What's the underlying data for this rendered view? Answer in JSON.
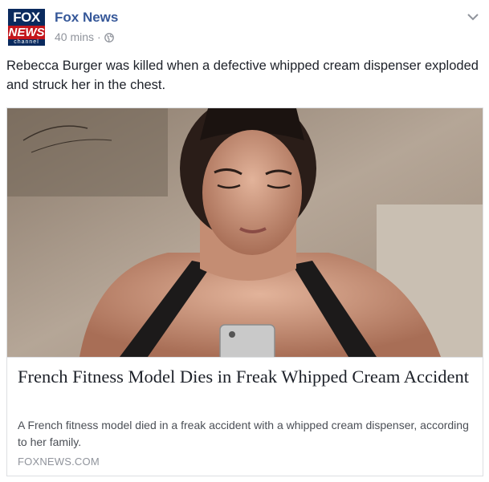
{
  "page": {
    "name": "Fox News",
    "logo_top": "FOX",
    "logo_bottom": "NEWS",
    "logo_channel": "channel"
  },
  "post": {
    "timestamp": "40 mins",
    "separator": "·",
    "privacy_icon": "globe-icon",
    "text": "Rebecca Burger was killed when a defective whipped cream dispenser exploded and struck her in the chest."
  },
  "link": {
    "title": "French Fitness Model Dies in Freak Whipped Cream Accident",
    "description": "A French fitness model died in a freak accident with a whipped cream dispenser, according to her family.",
    "domain": "FOXNEWS.COM"
  }
}
